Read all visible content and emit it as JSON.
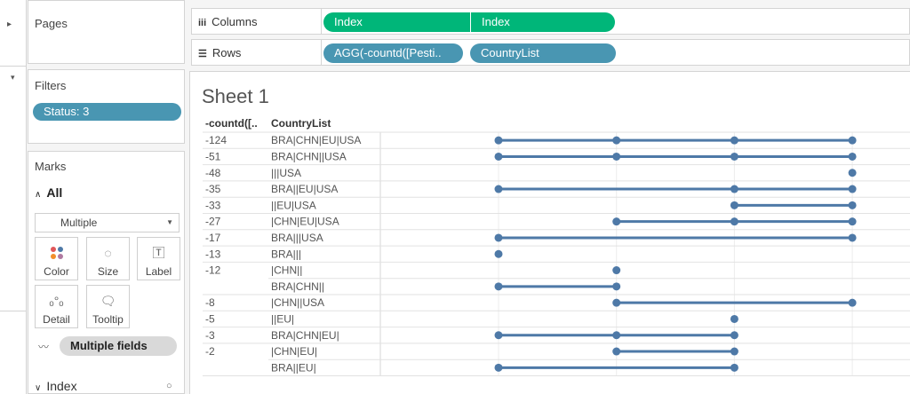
{
  "shelves": {
    "pages_label": "Pages",
    "filters_label": "Filters",
    "filter_pill": "Status: 3",
    "columns_label": "Columns",
    "rows_label": "Rows",
    "columns_pills": [
      "Index",
      "Index"
    ],
    "rows_pills": [
      "AGG(-countd([Pesti..",
      "CountryList"
    ]
  },
  "marks": {
    "title": "Marks",
    "all_label": "All",
    "mark_type": "Multiple",
    "buttons": {
      "color": "Color",
      "size": "Size",
      "label": "Label",
      "detail": "Detail",
      "tooltip": "Tooltip"
    },
    "multiple_fields": "Multiple fields",
    "index_label": "Index"
  },
  "sheet": {
    "title": "Sheet 1",
    "col_header_1": "-countd([..",
    "col_header_2": "CountryList"
  },
  "colors": {
    "pill_green": "#00b679",
    "pill_blue": "#4996b2",
    "series": "#4e79a7"
  },
  "chart_data": {
    "type": "line",
    "x_domain": [
      1,
      4
    ],
    "rows": [
      {
        "count": "-124",
        "list": "BRA|CHN|EU|USA",
        "points": [
          1,
          2,
          3,
          4
        ]
      },
      {
        "count": "-51",
        "list": "BRA|CHN||USA",
        "points": [
          1,
          2,
          3,
          4
        ]
      },
      {
        "count": "-48",
        "list": "|||USA",
        "points": [
          4
        ]
      },
      {
        "count": "-35",
        "list": "BRA||EU|USA",
        "points": [
          1,
          3,
          4
        ]
      },
      {
        "count": "-33",
        "list": "||EU|USA",
        "points": [
          3,
          4
        ]
      },
      {
        "count": "-27",
        "list": "|CHN|EU|USA",
        "points": [
          2,
          3,
          4
        ]
      },
      {
        "count": "-17",
        "list": "BRA|||USA",
        "points": [
          1,
          4
        ]
      },
      {
        "count": "-13",
        "list": "BRA|||",
        "points": [
          1
        ]
      },
      {
        "count": "-12",
        "list": "|CHN||",
        "points": [
          2
        ]
      },
      {
        "count": "",
        "list": "BRA|CHN||",
        "points": [
          1,
          2
        ]
      },
      {
        "count": "-8",
        "list": "|CHN||USA",
        "points": [
          2,
          4
        ]
      },
      {
        "count": "-5",
        "list": "||EU|",
        "points": [
          3
        ]
      },
      {
        "count": "-3",
        "list": "BRA|CHN|EU|",
        "points": [
          1,
          2,
          3
        ]
      },
      {
        "count": "-2",
        "list": "|CHN|EU|",
        "points": [
          2,
          3
        ]
      },
      {
        "count": "",
        "list": "BRA||EU|",
        "points": [
          1,
          3
        ]
      }
    ]
  }
}
